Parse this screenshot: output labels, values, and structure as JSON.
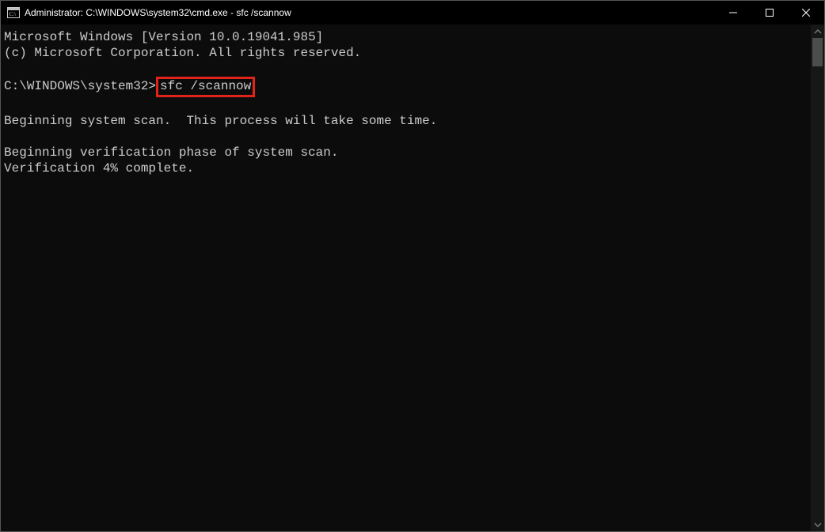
{
  "window": {
    "title": "Administrator: C:\\WINDOWS\\system32\\cmd.exe - sfc  /scannow"
  },
  "terminal": {
    "line_version": "Microsoft Windows [Version 10.0.19041.985]",
    "line_copyright": "(c) Microsoft Corporation. All rights reserved.",
    "prompt_prefix": "C:\\WINDOWS\\system32>",
    "command": "sfc /scannow",
    "line_begin_scan": "Beginning system scan.  This process will take some time.",
    "line_begin_verify": "Beginning verification phase of system scan.",
    "line_progress": "Verification 4% complete."
  }
}
